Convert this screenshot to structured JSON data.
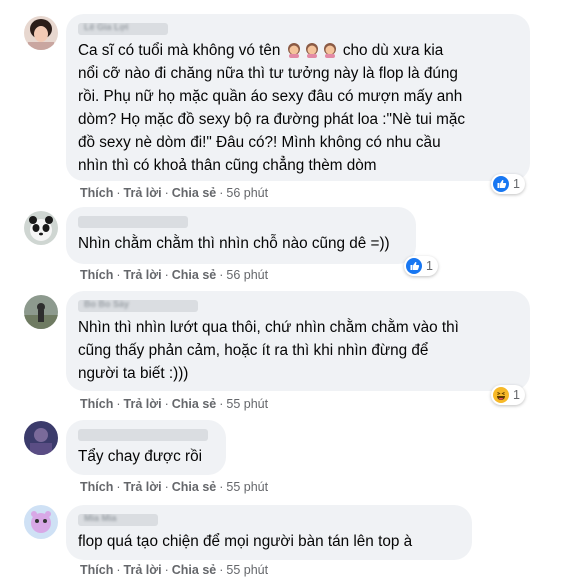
{
  "comments": [
    {
      "author": "Lê Gia Lợi",
      "text_lines": [
        "Ca sĩ có tuổi mà không vó tên",
        "nổi cỡ nào đi chăng nữa thì tư tưởng này là flop là đúng",
        "rồi. Phụ nữ họ mặc quần áo sexy đâu có mượn mấy anh",
        "dòm? Họ mặc đồ sexy bộ ra đường phát loa :\"Nè tui mặc",
        "đồ sexy nè dòm đi!\" Đâu có?! Mình không có nhu cầu",
        "nhìn thì có khoả thân cũng chẳng thèm dòm"
      ],
      "line1_suffix": " cho dù xưa kia",
      "emojis": [
        "woman-gesturing-icon",
        "woman-gesturing-icon",
        "woman-gesturing-icon"
      ],
      "like": "Thích",
      "reply": "Trả lời",
      "share": "Chia sẻ",
      "time": "56 phút",
      "reaction_icon": "like-icon",
      "reaction_count": "1"
    },
    {
      "author": "",
      "text_lines": [
        "Nhìn chằm chằm thì nhìn chỗ nào cũng dê =))"
      ],
      "like": "Thích",
      "reply": "Trả lời",
      "share": "Chia sẻ",
      "time": "56 phút",
      "reaction_icon": "like-icon",
      "reaction_count": "1"
    },
    {
      "author": "Bo Bo Sảy",
      "text_lines": [
        "Nhìn thì nhìn lướt qua thôi, chứ nhìn chằm chằm vào thì",
        "cũng thấy phản cảm, hoặc ít ra thì khi nhìn đừng để",
        "người ta biết :)))"
      ],
      "like": "Thích",
      "reply": "Trả lời",
      "share": "Chia sẻ",
      "time": "55 phút",
      "reaction_icon": "haha-icon",
      "reaction_count": "1"
    },
    {
      "author": "",
      "text_lines": [
        "Tẩy chay được rồi"
      ],
      "like": "Thích",
      "reply": "Trả lời",
      "share": "Chia sẻ",
      "time": "55 phút"
    },
    {
      "author": "Mia Mia",
      "text_lines": [
        "flop quá tạo chiện để mọi người bàn tán lên top à"
      ],
      "like": "Thích",
      "reply": "Trả lời",
      "share": "Chia sẻ",
      "time": "55 phút"
    }
  ],
  "colors": {
    "bubble": "#f0f2f5",
    "text": "#050505",
    "meta": "#65676b",
    "like_blue": "#1877f2",
    "haha_yellow": "#f7b928"
  }
}
